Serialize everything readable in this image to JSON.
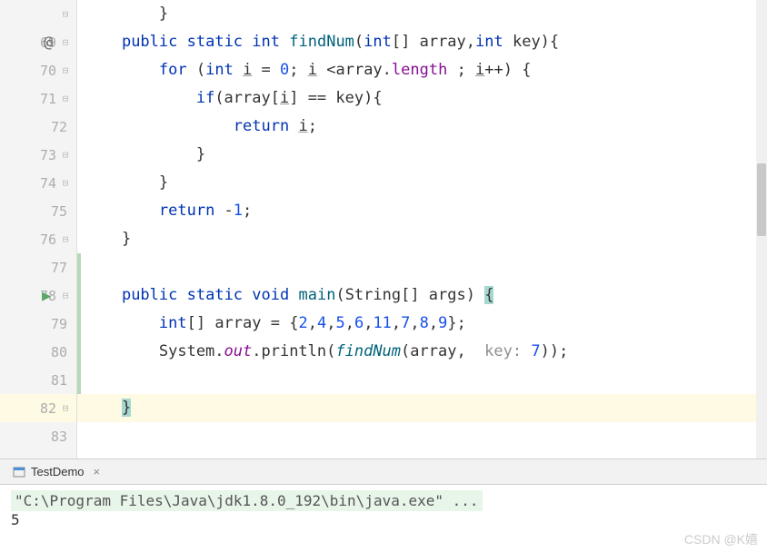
{
  "gutter": {
    "lines": [
      "69",
      "70",
      "71",
      "72",
      "73",
      "74",
      "75",
      "76",
      "77",
      "78",
      "79",
      "80",
      "81",
      "82",
      "83"
    ],
    "at_mark": "@",
    "run_icon": "▶",
    "fold": "⊟"
  },
  "code": {
    "l68_indent": "        }",
    "l69": {
      "indent": "    ",
      "public": "public",
      "static": "static",
      "int": "int",
      "method": "findNum",
      "paren_open": "(",
      "int2": "int",
      "arr": "[] array,",
      "int3": "int",
      "key": " key){"
    },
    "l70": {
      "indent": "        ",
      "for": "for",
      "paren": " (",
      "int": "int",
      "i": " ",
      "ivar": "i",
      "eq": " = ",
      "zero": "0",
      "semi": "; ",
      "ivar2": "i",
      "lt": " <array.",
      "length": "length",
      "rest": " ; ",
      "ivar3": "i",
      "inc": "++) {"
    },
    "l71": {
      "indent": "            ",
      "if": "if",
      "rest1": "(array[",
      "ivar": "i",
      "rest2": "] == key){"
    },
    "l72": {
      "indent": "                ",
      "return": "return",
      "sp": " ",
      "ivar": "i",
      "semi": ";"
    },
    "l73": "            }",
    "l74": "        }",
    "l75": {
      "indent": "        ",
      "return": "return",
      "rest": " -",
      "one": "1",
      "semi": ";"
    },
    "l76": "    }",
    "l77": "",
    "l78": {
      "indent": "    ",
      "public": "public",
      "static": "static",
      "void": "void",
      "main": "main",
      "paren": "(String[] args) ",
      "brace": "{"
    },
    "l79": {
      "indent": "        ",
      "int": "int",
      "arr": "[] array = {",
      "n1": "2",
      "c1": ",",
      "n2": "4",
      "c2": ",",
      "n3": "5",
      "c3": ",",
      "n4": "6",
      "c4": ",",
      "n5": "11",
      "c5": ",",
      "n6": "7",
      "c6": ",",
      "n7": "8",
      "c7": ",",
      "n8": "9",
      "end": "};"
    },
    "l80": {
      "indent": "        System.",
      "out": "out",
      "dot": ".println(",
      "findNum": "findNum",
      "paren": "(array, ",
      "hint": " key: ",
      "seven": "7",
      "end": "));"
    },
    "l81": "",
    "l82": {
      "indent": "    ",
      "brace": "}"
    },
    "l83": ""
  },
  "console": {
    "tab_name": "TestDemo",
    "close": "×",
    "line1": "\"C:\\Program Files\\Java\\jdk1.8.0_192\\bin\\java.exe\" ...",
    "line2": "5"
  },
  "watermark": "CSDN @K嬉"
}
